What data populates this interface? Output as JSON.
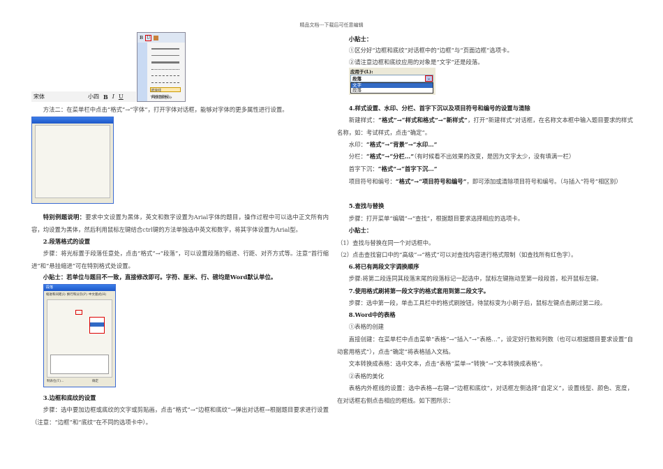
{
  "header": "精品文档---下载后可任意编辑",
  "toolbar_image": {
    "font": "宋体",
    "size": "小四",
    "bold": "B",
    "italic": "I",
    "underline": "U",
    "underline_color": "下划线颜色(I)",
    "more": "其他下划线...",
    "wavy": "波浪线"
  },
  "left": {
    "method2": "方法二：在菜单栏中点击“格式”→“字体”，打开字体对话框，能够对字体的更多属性进行设置。",
    "example_label": "特别例题说明：",
    "example_text": "要求中文设置为黑体，英文和数字设置为Arial字体的题目，操作过程中可以选中正文所有内容，均设置为黑体，然后利用鼠标左键结合ctrl键的方法单独选中英文和数字，将其字体设置为Arial型。",
    "h2": "2.段落格式的设置",
    "para_steps": "步骤：将光标置于段落任意处，点击“格式”→“段落”，可以设置段落的缩进、行距、对齐方式等。注意“首行缩进”和“悬挂缩进”可在特别格式处设置。",
    "tip": "小贴士：若单位与题目不一致，直接修改即可。字符、厘米、行、磅均是Word默认单位。",
    "para_dialog": {
      "title": "段落",
      "tabs": [
        "缩进和间距(I)",
        "换行和分页(P)",
        "中文版式(H)"
      ],
      "tabs_btn": "制表位(T)...",
      "ok": "确定"
    },
    "h3": "3.边框和底纹的设置",
    "border_steps": "步骤：选中要加边框或底纹的文字或剪贴画，点击“格式”→“边框和底纹”→弹出对话框→根据题目要求进行设置（注意：“边框”和“底纹”在不同的选项卡中）。"
  },
  "right": {
    "tip_label": "小贴士：",
    "tip1": "①区分好“边框和底纹”对话框中的“边框”与“页面边框”选项卡。",
    "tip2": "②请注意边框和底纹应用的对象是“文字”还是段落。",
    "apply": {
      "label": "应用于(L):",
      "value": "段落",
      "options": [
        "文字",
        "段落"
      ]
    },
    "h4": "4.样式设置、水印、分栏、首字下沉以及项目符号和编号的设置与清除",
    "style_pre": "新建样式：",
    "style_path": "“格式”→“样式和格式”→“新样式”",
    "style_post": "，打开“新建样式”对话框，在名称文本框中输入题目要求的样式名称，如：考试样式，点击“确定”。",
    "wm_pre": "水印：",
    "wm_path": "“格式”→“背景”→“水印…”",
    "col_pre": "分栏：",
    "col_path": "“格式”→“分栏…”",
    "col_post": "（有时候看不出效果的改变，是因为文字太少，没有填满一栏）",
    "drop_pre": "首字下沉：",
    "drop_path": "“格式”→“首字下沉…”",
    "bullet_pre": "项目符号和编号：",
    "bullet_path": "“格式”→“项目符号和编号”",
    "bullet_post": "，即可添加或清除项目符号和编号。（与插入“符号”相区别）",
    "h5": "5.查找与替换",
    "find_steps": "步骤：打开菜单“编辑”→“查找”，根据题目要求选择相应的选项卡。",
    "tip_label2": "小贴士：",
    "find1": "（1）查找与替换在同一个对话框中。",
    "find2": "（2）点击查找窗口中的“高级”→“格式”可以对查找内容进行格式限制（如查找所有红色字）。",
    "h6": "6.将已有两段文字调换顺序",
    "swap_steps": "步骤:将第二段连同其段落末尾的段落标记一起选中，鼠标左键拖动至第一段段首，松开鼠标左键。",
    "h7": "7.使用格式刷将第一段文字的格式套用到第二段文字。",
    "brush_steps": "步骤：选中第一段，单击工具栏中的格式刷按钮，待鼠标变为小刷子后，鼠标左键点击刷过第二段。",
    "h8": "8.Word中的表格",
    "t1": "①表格的创建",
    "t1a": "直接创建：在菜单栏中点击菜单“表格”→“插入”→“表格…”，设定好行数和列数（也可以根据题目要求设置“自动套用格式”），点击“确定”将表格插入文档。",
    "t1b": "文本转换成表格：选中文本，点击“表格”菜单→“转换”→“文本转换成表格”。",
    "t2": "②表格的美化",
    "t2a": "表格内外框线的设置：选中表格→右键→“边框和底纹”，对话框左侧选择“自定义”，设置线型、颜色、宽度，在对话框右侧点击相应的框线。如下图所示："
  }
}
